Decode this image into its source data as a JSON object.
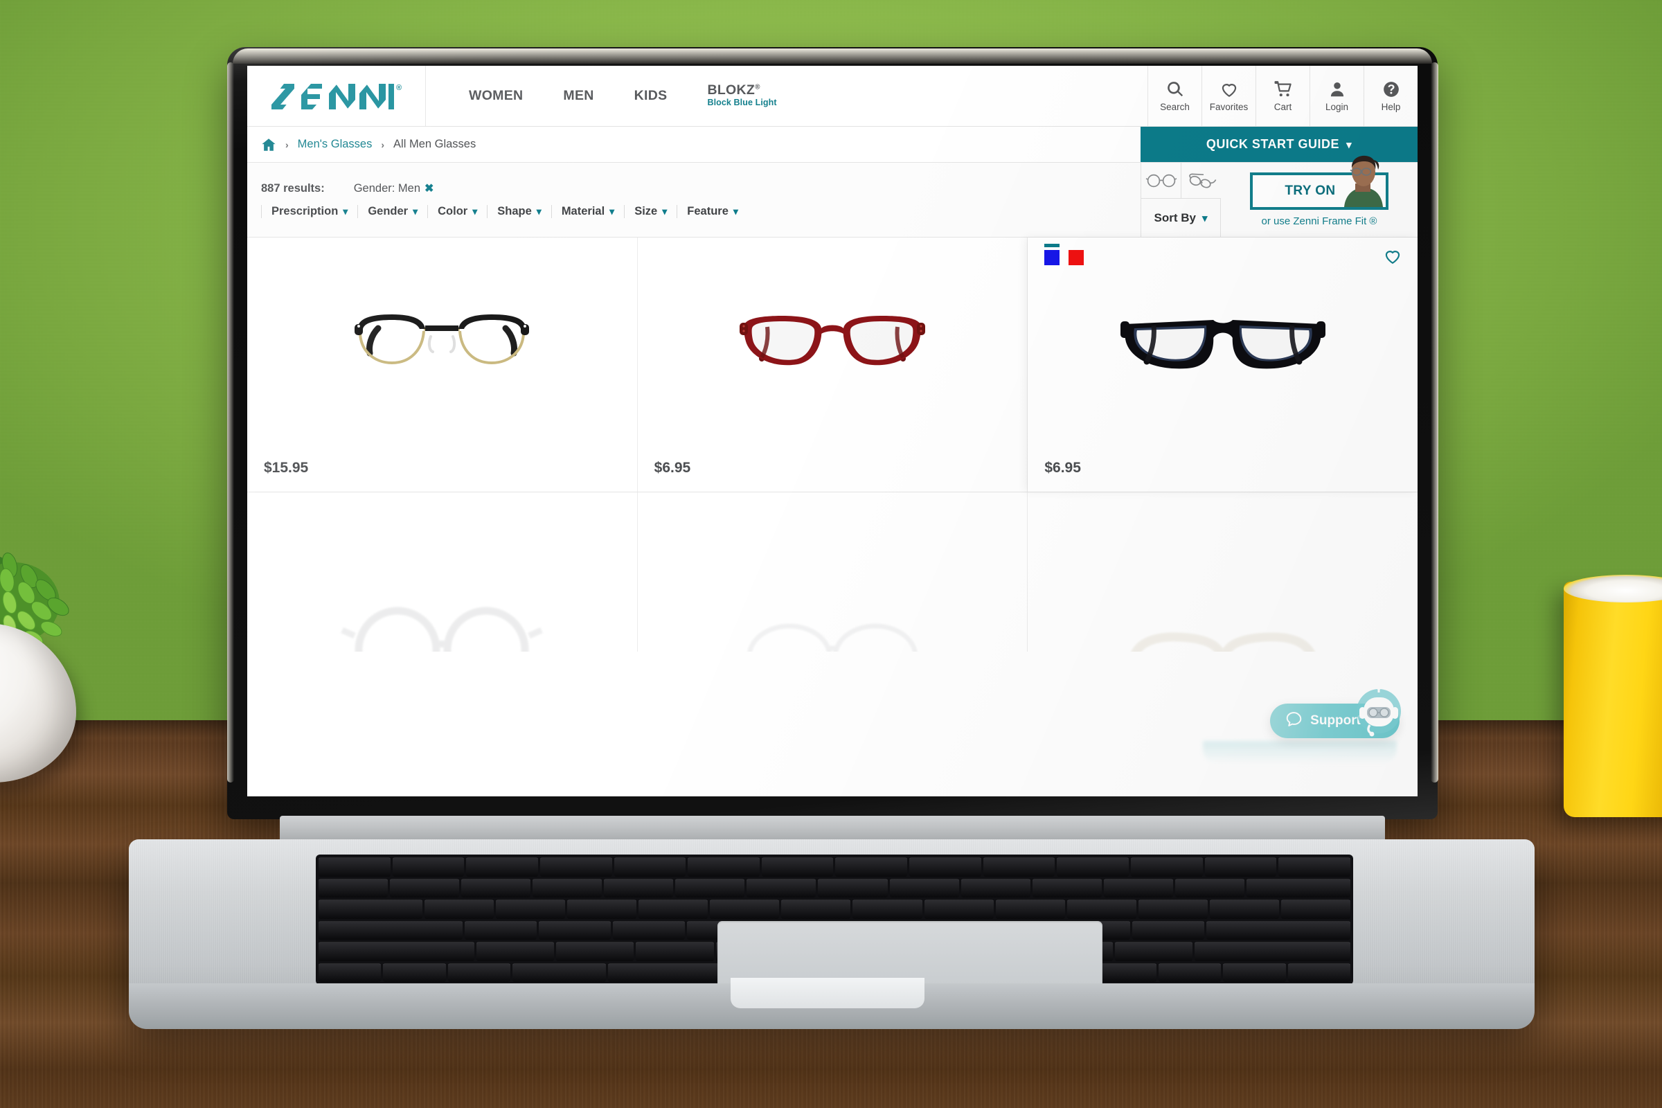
{
  "brand": {
    "name": "ZENNI",
    "registered": "®",
    "accent": "#127f8c",
    "dark_teal": "#0c7b8a"
  },
  "topnav": {
    "menu": [
      {
        "label": "WOMEN",
        "sub": ""
      },
      {
        "label": "MEN",
        "sub": ""
      },
      {
        "label": "KIDS",
        "sub": ""
      },
      {
        "label": "BLOKZ",
        "sup": "®",
        "sub": "Block Blue Light"
      }
    ],
    "icons": [
      {
        "name": "search-icon",
        "label": "Search"
      },
      {
        "name": "heart-icon",
        "label": "Favorites"
      },
      {
        "name": "cart-icon",
        "label": "Cart"
      },
      {
        "name": "user-icon",
        "label": "Login"
      },
      {
        "name": "help-icon",
        "label": "Help"
      }
    ]
  },
  "breadcrumb": {
    "home_icon": "home-icon",
    "separator": "›",
    "link": "Men's Glasses",
    "current": "All Men Glasses"
  },
  "quick_start": {
    "label": "QUICK START GUIDE",
    "chevron": "⌄"
  },
  "filters": {
    "results_count": "887 results:",
    "active_chip": {
      "label": "Gender: Men",
      "remove": "✖"
    },
    "dropdowns": [
      {
        "label": "Prescription"
      },
      {
        "label": "Gender"
      },
      {
        "label": "Color"
      },
      {
        "label": "Shape"
      },
      {
        "label": "Material"
      },
      {
        "label": "Size"
      },
      {
        "label": "Feature"
      }
    ],
    "chevron": "⌄"
  },
  "view_toggle": {
    "front_view": "glasses-front-icon",
    "angle_view": "glasses-angle-icon"
  },
  "sort": {
    "label": "Sort By",
    "chevron": "⌄"
  },
  "try_on": {
    "button_label": "TRY ON",
    "alt_label": "or use Zenni Frame Fit ®",
    "model_icon": "model-avatar"
  },
  "products": [
    {
      "name": "browline-black-gold-glasses",
      "price": "$15.95",
      "swatches": [],
      "favorited": false,
      "frame_style": "browline"
    },
    {
      "name": "red-rectangle-glasses",
      "price": "$6.95",
      "swatches": [],
      "favorited": false,
      "frame_style": "rounded-rectangle"
    },
    {
      "name": "black-blue-rectangle-glasses",
      "price": "$6.95",
      "swatches": [
        {
          "color": "#1616e8",
          "label": "blue",
          "selected": true
        },
        {
          "color": "#ef1111",
          "label": "red",
          "selected": false
        }
      ],
      "favorited": false,
      "frame_style": "rectangle"
    }
  ],
  "products_row2": [
    {
      "name": "partial-glasses-1"
    },
    {
      "name": "partial-glasses-2"
    },
    {
      "name": "partial-glasses-3"
    }
  ],
  "support_widget": {
    "label": "Support",
    "chat_icon": "chat-bubble-icon",
    "mascot": "robot-mascot-icon"
  },
  "scene": {
    "wall_color": "#8cbb4a",
    "desk_color": "#5e3c1e",
    "mug_color": "#ffd615",
    "plant": "succulent-in-white-pot",
    "device": "silver-laptop"
  }
}
